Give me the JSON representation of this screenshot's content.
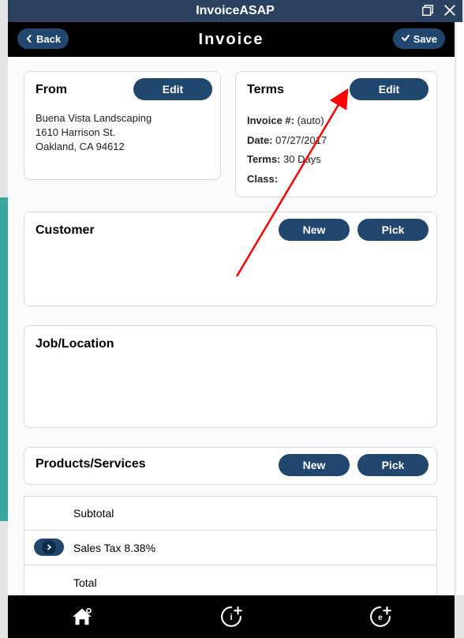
{
  "window": {
    "title": "InvoiceASAP"
  },
  "nav": {
    "back": "Back",
    "title": "Invoice",
    "save": "Save"
  },
  "from": {
    "heading": "From",
    "edit": "Edit",
    "name": "Buena Vista Landscaping",
    "addr1": "1610 Harrison St.",
    "addr2": "Oakland, CA 94612"
  },
  "terms": {
    "heading": "Terms",
    "edit": "Edit",
    "invoice_label": "Invoice #:",
    "invoice_value": "(auto)",
    "date_label": "Date:",
    "date_value": "07/27/2017",
    "terms_label": "Terms:",
    "terms_value": "30 Days",
    "class_label": "Class:",
    "class_value": ""
  },
  "customer": {
    "heading": "Customer",
    "new": "New",
    "pick": "Pick"
  },
  "job": {
    "heading": "Job/Location"
  },
  "products": {
    "heading": "Products/Services",
    "new": "New",
    "pick": "Pick"
  },
  "totals": {
    "subtotal": "Subtotal",
    "salestax": "Sales Tax 8.38%",
    "total": "Total"
  }
}
